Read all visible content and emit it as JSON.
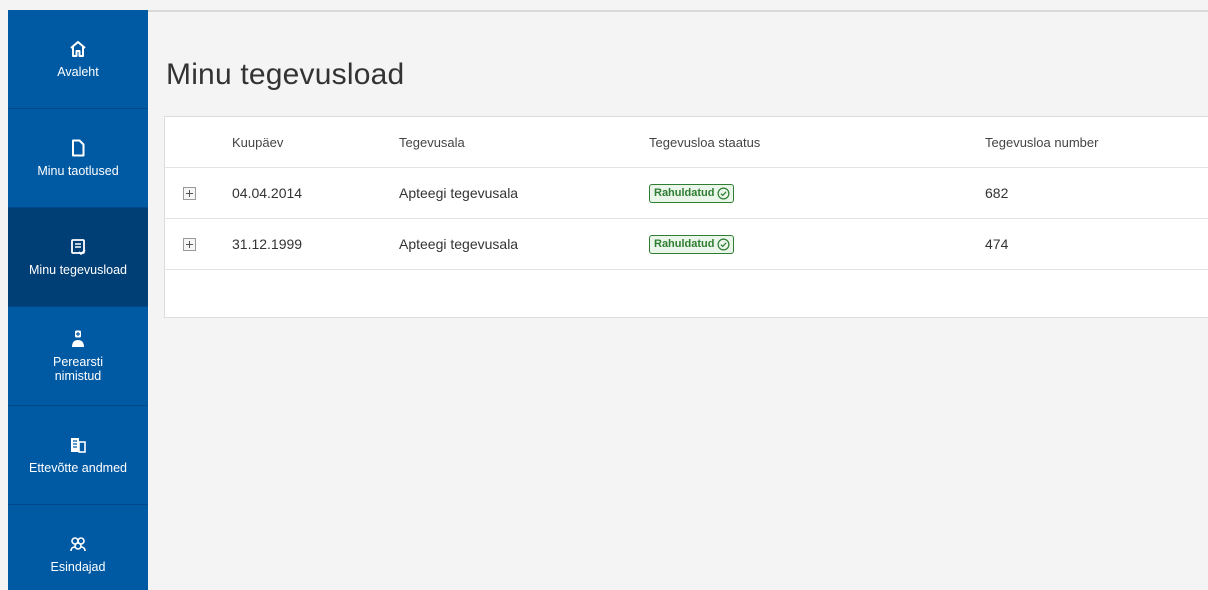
{
  "sidebar": {
    "items": [
      {
        "label": "Avaleht",
        "icon": "home-icon"
      },
      {
        "label": "Minu taotlused",
        "icon": "document-icon"
      },
      {
        "label": "Minu tegevusload",
        "icon": "license-icon"
      },
      {
        "label": "Perearsti\nnimistud",
        "icon": "doctor-icon"
      },
      {
        "label": "Ettevõtte andmed",
        "icon": "building-icon"
      },
      {
        "label": "Esindajad",
        "icon": "people-icon"
      }
    ],
    "active_index": 2
  },
  "page": {
    "title": "Minu tegevusload"
  },
  "table": {
    "columns": [
      "Kuupäev",
      "Tegevusala",
      "Tegevusloa staatus",
      "Tegevusloa number"
    ],
    "rows": [
      {
        "date": "04.04.2014",
        "area": "Apteegi tegevusala",
        "status": "Rahuldatud",
        "number": "682"
      },
      {
        "date": "31.12.1999",
        "area": "Apteegi tegevusala",
        "status": "Rahuldatud",
        "number": "474"
      }
    ]
  },
  "colors": {
    "sidebar_bg": "#005aa3",
    "sidebar_active": "#003e76",
    "status_green": "#2e7d32"
  }
}
